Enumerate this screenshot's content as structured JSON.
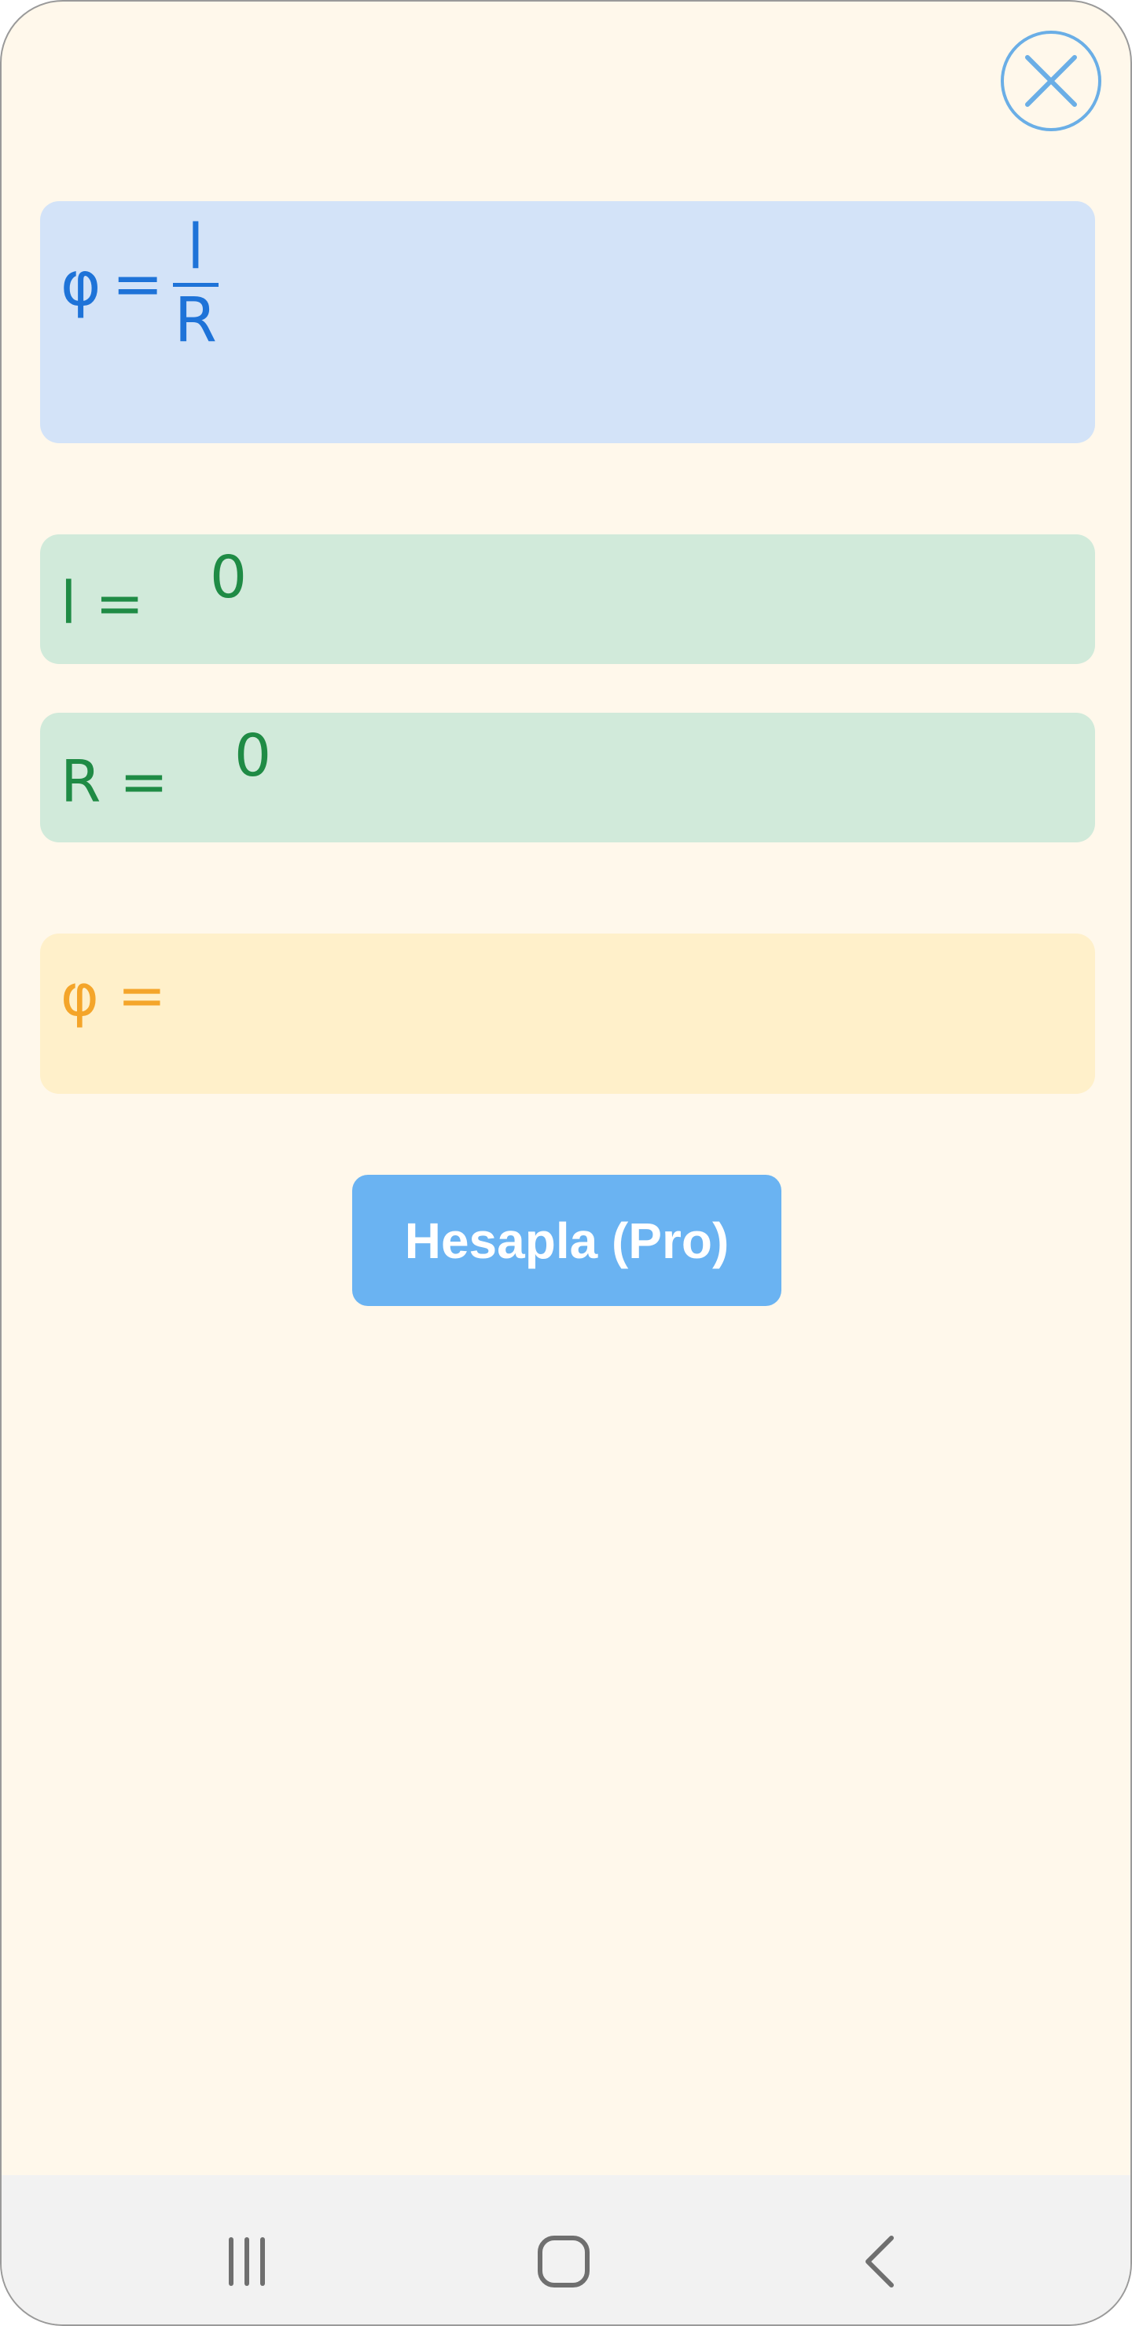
{
  "close": {
    "icon": "close-icon"
  },
  "formula": {
    "symbol": "φ",
    "equals": "=",
    "numerator": "l",
    "denominator": "R"
  },
  "inputs": [
    {
      "label": "l =",
      "value": "0"
    },
    {
      "label": "R =",
      "value": "0"
    }
  ],
  "result": {
    "label": "φ =",
    "value": ""
  },
  "calculate_button": {
    "label": "Hesapla (Pro)"
  },
  "nav": {
    "recents_icon": "recents-icon",
    "home_icon": "home-icon",
    "back_icon": "back-icon"
  },
  "colors": {
    "background": "#fff8eb",
    "formula_card": "#d3e3f8",
    "formula_text": "#1e73d8",
    "input_card": "#d1eada",
    "input_text": "#1f8b45",
    "result_card": "#fff0ca",
    "result_text": "#f4a52a",
    "button": "#6ab3f2",
    "close_icon": "#6aaee6"
  }
}
